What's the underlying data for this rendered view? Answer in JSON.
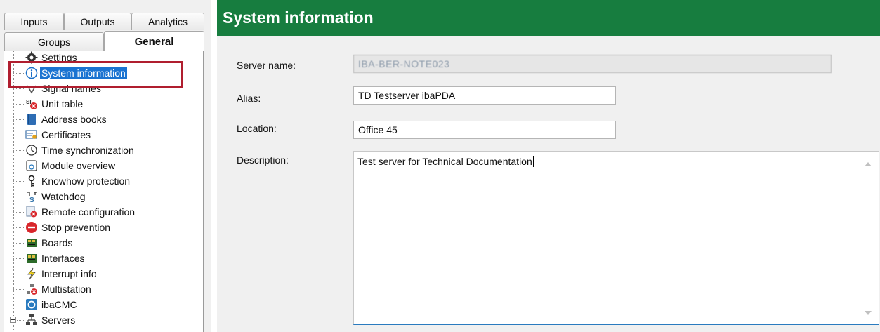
{
  "tabs": {
    "row1": [
      "Inputs",
      "Outputs",
      "Analytics"
    ],
    "row2": [
      "Groups",
      "General"
    ]
  },
  "tree": {
    "items": [
      {
        "label": "Settings",
        "icon": "gear-icon"
      },
      {
        "label": "System information",
        "icon": "info-icon",
        "selected": true
      },
      {
        "label": "Signal names",
        "icon": "signal-icon"
      },
      {
        "label": "Unit table",
        "icon": "unit-table-icon"
      },
      {
        "label": "Address books",
        "icon": "address-book-icon"
      },
      {
        "label": "Certificates",
        "icon": "certificate-icon"
      },
      {
        "label": "Time synchronization",
        "icon": "clock-icon"
      },
      {
        "label": "Module overview",
        "icon": "module-icon"
      },
      {
        "label": "Knowhow protection",
        "icon": "key-icon"
      },
      {
        "label": "Watchdog",
        "icon": "watchdog-icon"
      },
      {
        "label": "Remote configuration",
        "icon": "remote-config-icon"
      },
      {
        "label": "Stop prevention",
        "icon": "stop-icon"
      },
      {
        "label": "Boards",
        "icon": "board-icon"
      },
      {
        "label": "Interfaces",
        "icon": "interface-icon"
      },
      {
        "label": "Interrupt info",
        "icon": "lightning-icon"
      },
      {
        "label": "Multistation",
        "icon": "multistation-icon"
      },
      {
        "label": "ibaCMC",
        "icon": "ibacmc-icon"
      },
      {
        "label": "Servers",
        "icon": "servers-icon"
      }
    ]
  },
  "header": {
    "title": "System information"
  },
  "form": {
    "server_name_label": "Server name:",
    "server_name_value": "IBA-BER-NOTE023",
    "alias_label": "Alias:",
    "alias_value": "TD Testserver ibaPDA",
    "location_label": "Location:",
    "location_value": "Office 45",
    "description_label": "Description:",
    "description_value": "Test server for Technical Documentation"
  },
  "colors": {
    "header_bg": "#177d3f",
    "selection": "#1a73d1",
    "highlight_box": "#b01e2f"
  }
}
